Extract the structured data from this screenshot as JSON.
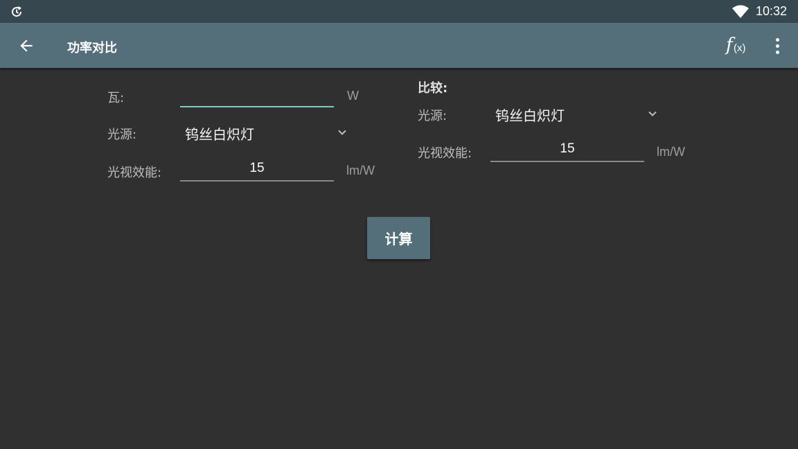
{
  "status_bar": {
    "time": "10:32",
    "icons": [
      "sync-icon",
      "wifi-icon"
    ]
  },
  "app_bar": {
    "title": "功率对比",
    "back_icon": "arrow-back-icon",
    "fx_label": {
      "f": "f",
      "x": "(x)"
    },
    "more_icon": "more-vert-icon"
  },
  "left_form": {
    "watt": {
      "label": "瓦:",
      "value": "",
      "unit": "W"
    },
    "light_source": {
      "label": "光源:",
      "selected": "钨丝白炽灯"
    },
    "efficacy": {
      "label": "光视效能:",
      "value": "15",
      "unit": "lm/W"
    }
  },
  "right_form": {
    "title": "比较:",
    "light_source": {
      "label": "光源:",
      "selected": "钨丝白炽灯"
    },
    "efficacy": {
      "label": "光视效能:",
      "value": "15",
      "unit": "lm/W"
    }
  },
  "calculate_button": {
    "label": "计算"
  },
  "colors": {
    "status_bar": "#37474f",
    "app_bar": "#546e7a",
    "background": "#303030",
    "focus_accent": "#80cbc4"
  }
}
